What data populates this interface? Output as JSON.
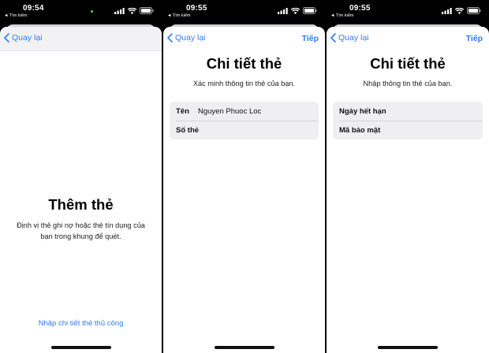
{
  "screens": [
    {
      "status": {
        "time": "09:54",
        "back_app": "◄ Tìm kiếm"
      },
      "nav": {
        "back_label": "Quay lại",
        "next_label": ""
      },
      "title": "Thêm thẻ",
      "subtitle_lines": [
        "Định vị thẻ ghi nợ hoặc thẻ tín dụng của",
        "bạn trong khung để quét."
      ],
      "manual_link": "Nhập chi tiết thẻ thủ công"
    },
    {
      "status": {
        "time": "09:55",
        "back_app": "◄ Tìm kiếm"
      },
      "nav": {
        "back_label": "Quay lại",
        "next_label": "Tiếp"
      },
      "title": "Chi tiết thẻ",
      "subtitle": "Xác minh thông tin thẻ của bạn.",
      "fields": [
        {
          "label": "Tên",
          "value": "Nguyen Phuoc Loc"
        },
        {
          "label": "Số thẻ",
          "value": ""
        }
      ]
    },
    {
      "status": {
        "time": "09:55",
        "back_app": "◄ Tìm kiếm"
      },
      "nav": {
        "back_label": "Quay lại",
        "next_label": "Tiếp"
      },
      "title": "Chi tiết thẻ",
      "subtitle": "Nhập thông tin thẻ của bạn.",
      "fields": [
        {
          "label": "Ngày hết hạn",
          "value": ""
        },
        {
          "label": "Mã bảo mật",
          "value": ""
        }
      ]
    }
  ],
  "icons": {
    "back": "chevron-left-icon",
    "signal": "cellular-signal-icon",
    "wifi": "wifi-icon",
    "battery": "battery-icon"
  },
  "colors": {
    "accent": "#2f7cf6",
    "status_bar": "#000000",
    "grouped_background": "#efeff2",
    "camera_indicator": "#3ddc58"
  }
}
